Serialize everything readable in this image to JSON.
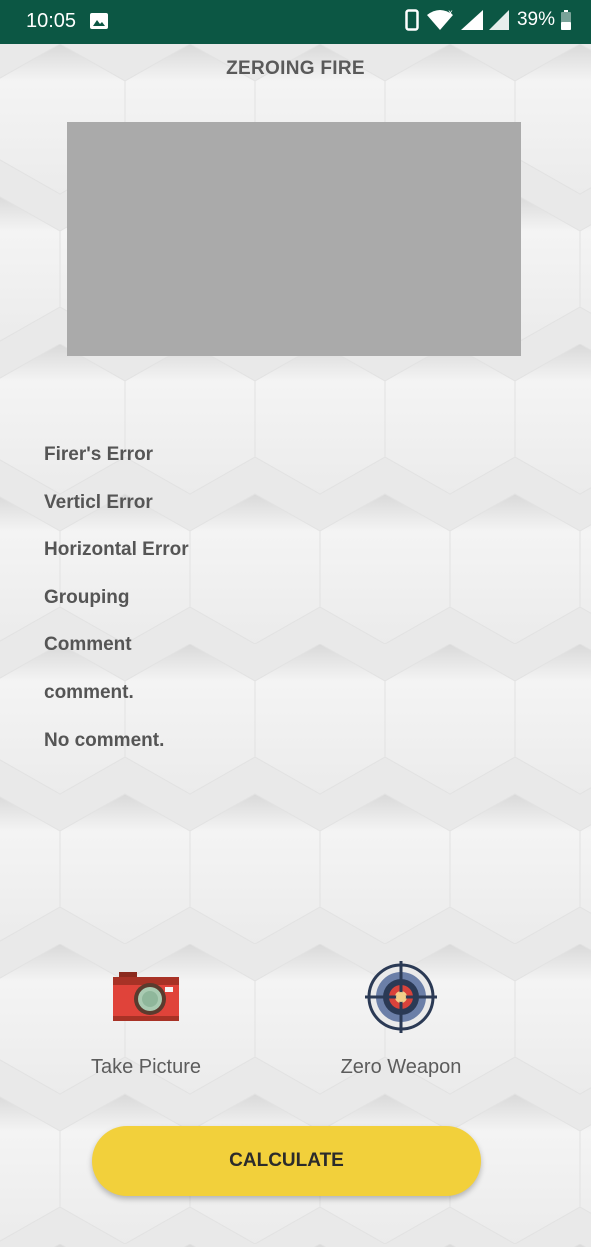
{
  "status_bar": {
    "time": "10:05",
    "battery_percent": "39%",
    "color": "#0c5744"
  },
  "page": {
    "title": "ZEROING FIRE"
  },
  "info_lines": [
    "Firer's Error",
    "Verticl Error",
    "Horizontal Error",
    "Grouping",
    "Comment",
    "comment.",
    "No comment."
  ],
  "actions": {
    "take_picture": {
      "label": "Take Picture",
      "icon": "camera-icon"
    },
    "zero_weapon": {
      "label": "Zero Weapon",
      "icon": "target-icon"
    }
  },
  "calculate_button": {
    "label": "CALCULATE",
    "color": "#f2d03b"
  }
}
